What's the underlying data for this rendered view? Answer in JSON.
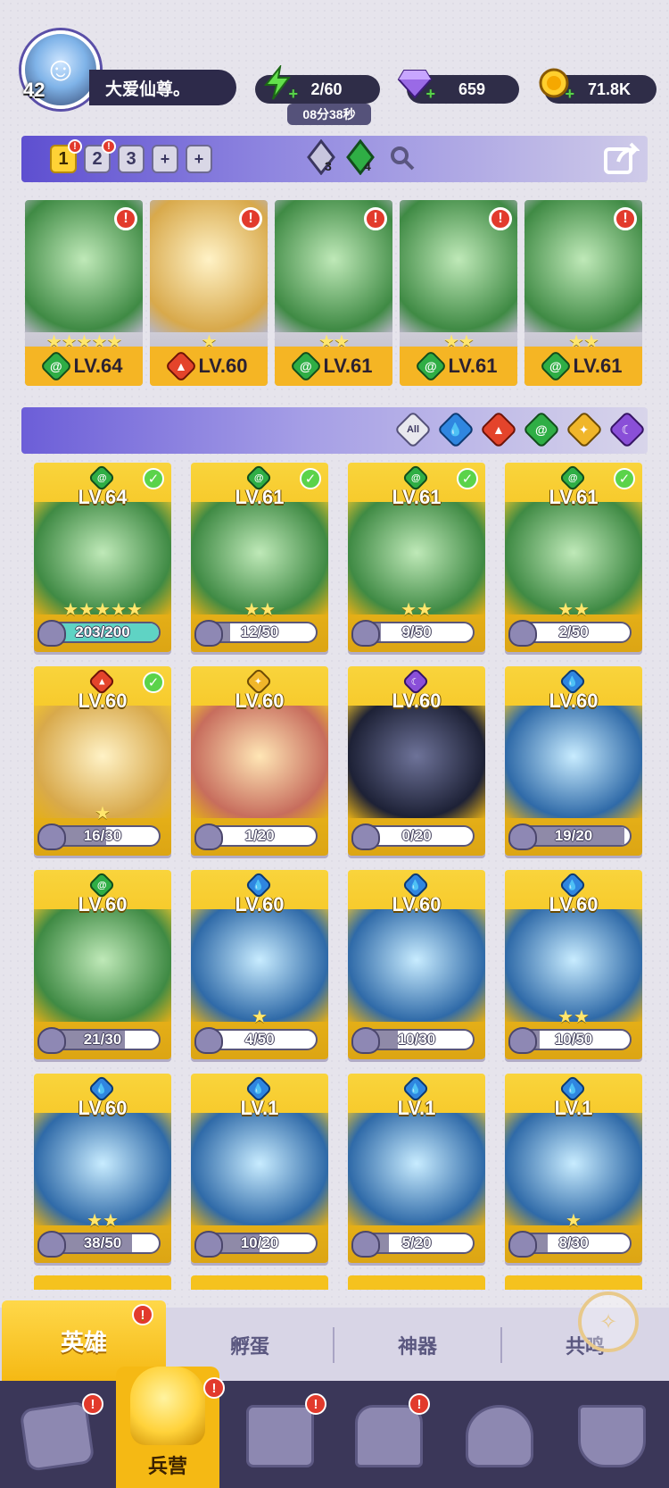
{
  "player": {
    "level": "42",
    "name": "大爱仙尊。"
  },
  "resources": {
    "energy": "2/60",
    "energy_timer": "08分38秒",
    "gems": "659",
    "gold": "71.8K"
  },
  "team": {
    "slots": [
      "1",
      "2",
      "3"
    ],
    "add_slots": [
      "+",
      "+"
    ],
    "water_gem_count": "3",
    "wind_gem_count": "4",
    "members": [
      {
        "element": "wind",
        "stars": "★★★★★",
        "level": "LV.64",
        "alert": "!"
      },
      {
        "element": "fire",
        "stars": "★",
        "level": "LV.60",
        "alert": "!"
      },
      {
        "element": "wind",
        "stars": "★★",
        "level": "LV.61",
        "alert": "!"
      },
      {
        "element": "wind",
        "stars": "★★",
        "level": "LV.61",
        "alert": "!"
      },
      {
        "element": "wind",
        "stars": "★★",
        "level": "LV.61",
        "alert": "!"
      }
    ]
  },
  "filters": {
    "all_label": "All"
  },
  "heroes": [
    {
      "element": "wind",
      "level": "LV.64",
      "progress": "203/200",
      "fill": 1.0,
      "checked": true,
      "stars": "★★★★★"
    },
    {
      "element": "wind",
      "level": "LV.61",
      "progress": "12/50",
      "fill": 0.24,
      "checked": true,
      "stars": "★★"
    },
    {
      "element": "wind",
      "level": "LV.61",
      "progress": "9/50",
      "fill": 0.18,
      "checked": true,
      "stars": "★★"
    },
    {
      "element": "wind",
      "level": "LV.61",
      "progress": "2/50",
      "fill": 0.04,
      "checked": true,
      "stars": "★★"
    },
    {
      "element": "fire",
      "level": "LV.60",
      "progress": "16/30",
      "fill": 0.53,
      "checked": true,
      "stars": "★"
    },
    {
      "element": "light",
      "level": "LV.60",
      "progress": "1/20",
      "fill": 0.05,
      "checked": false,
      "stars": ""
    },
    {
      "element": "dark",
      "level": "LV.60",
      "progress": "0/20",
      "fill": 0.0,
      "checked": false,
      "stars": ""
    },
    {
      "element": "water",
      "level": "LV.60",
      "progress": "19/20",
      "fill": 0.95,
      "checked": false,
      "stars": ""
    },
    {
      "element": "wind",
      "level": "LV.60",
      "progress": "21/30",
      "fill": 0.7,
      "checked": false,
      "stars": ""
    },
    {
      "element": "water",
      "level": "LV.60",
      "progress": "4/50",
      "fill": 0.08,
      "checked": false,
      "stars": "★"
    },
    {
      "element": "water",
      "level": "LV.60",
      "progress": "10/30",
      "fill": 0.33,
      "checked": false,
      "stars": ""
    },
    {
      "element": "water",
      "level": "LV.60",
      "progress": "10/50",
      "fill": 0.2,
      "checked": false,
      "stars": "★★"
    },
    {
      "element": "water",
      "level": "LV.60",
      "progress": "38/50",
      "fill": 0.76,
      "checked": false,
      "stars": "★★"
    },
    {
      "element": "water",
      "level": "LV.1",
      "progress": "10/20",
      "fill": 0.5,
      "checked": false,
      "stars": ""
    },
    {
      "element": "water",
      "level": "LV.1",
      "progress": "5/20",
      "fill": 0.25,
      "checked": false,
      "stars": ""
    },
    {
      "element": "water",
      "level": "LV.1",
      "progress": "8/30",
      "fill": 0.27,
      "checked": false,
      "stars": "★"
    }
  ],
  "tabs": {
    "heroes": "英雄",
    "hatch": "孵蛋",
    "artifacts": "神器",
    "resonance": "共鸣"
  },
  "nav": {
    "barracks": "兵营"
  },
  "colors": {
    "wind": "#2fae45",
    "fire": "#e4442b",
    "water": "#2f86e0",
    "light": "#f0b62a",
    "dark": "#8a4fd8",
    "gold_card": "#f5c21e"
  }
}
